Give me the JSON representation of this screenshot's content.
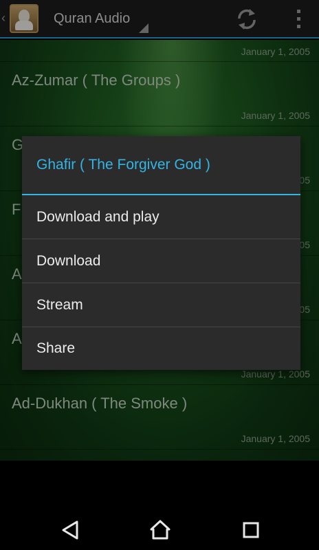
{
  "actionbar": {
    "title": "Quran Audio",
    "icons": {
      "app": "sheikh-avatar-icon",
      "refresh": "refresh-icon",
      "overflow": "overflow-menu-icon"
    }
  },
  "list": {
    "items": [
      {
        "title": "",
        "date": "January 1, 2005"
      },
      {
        "title": "Az-Zumar ( The Groups )",
        "date": "January 1, 2005"
      },
      {
        "title": "G",
        "date": "2005"
      },
      {
        "title": "F",
        "date": "2005"
      },
      {
        "title": "A",
        "date": "2005"
      },
      {
        "title": "A",
        "date": "January 1, 2005"
      },
      {
        "title": "Ad-Dukhan ( The Smoke )",
        "date": "January 1, 2005"
      }
    ]
  },
  "dialog": {
    "title": "Ghafir ( The Forgiver God )",
    "options": [
      "Download and play",
      "Download",
      "Stream",
      "Share"
    ]
  },
  "navbar": {
    "icons": [
      "back-icon",
      "home-icon",
      "recents-icon"
    ]
  },
  "colors": {
    "accent": "#33b5e5",
    "dialog_bg": "#2b2b2b",
    "actionbar_bg": "#1d1d1d"
  }
}
